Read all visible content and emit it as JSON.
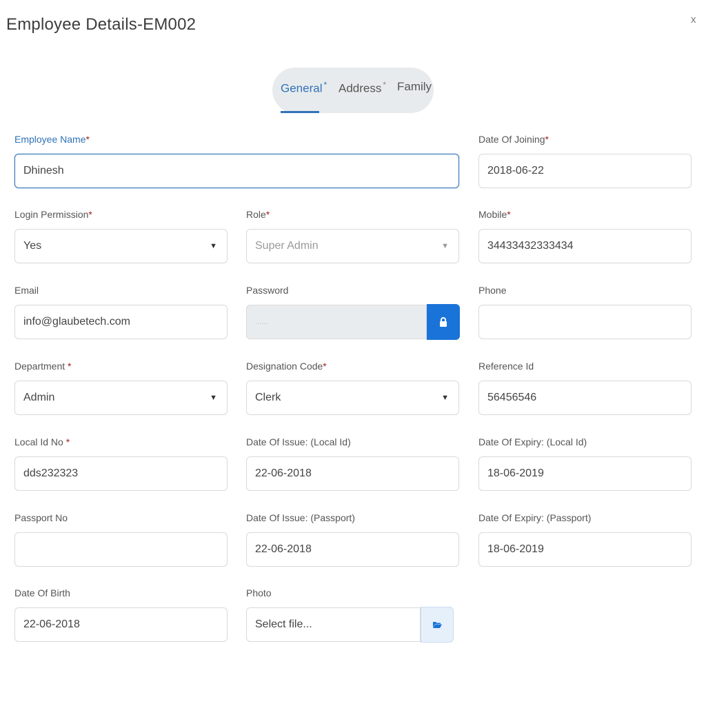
{
  "header": {
    "title": "Employee Details-EM002",
    "close": "x"
  },
  "tabs": [
    {
      "label": "General",
      "marker": "*"
    },
    {
      "label": "Address",
      "marker": "*"
    },
    {
      "label": "Family"
    }
  ],
  "form": {
    "employee_name": {
      "label": "Employee Name",
      "required": "*",
      "value": "Dhinesh"
    },
    "date_of_joining": {
      "label": "Date Of Joining",
      "required": "*",
      "value": "2018-06-22"
    },
    "login_permission": {
      "label": "Login Permission",
      "required": "*",
      "value": "Yes"
    },
    "role": {
      "label": "Role",
      "required": "*",
      "value": "Super Admin"
    },
    "mobile": {
      "label": "Mobile",
      "required": "*",
      "value": "34433432333434"
    },
    "email": {
      "label": "Email",
      "value": "info@glaubetech.com"
    },
    "password": {
      "label": "Password",
      "value": "......"
    },
    "phone": {
      "label": "Phone",
      "value": ""
    },
    "department": {
      "label": "Department ",
      "required": "*",
      "value": "Admin"
    },
    "designation_code": {
      "label": "Designation Code",
      "required": "*",
      "value": "Clerk"
    },
    "reference_id": {
      "label": "Reference Id",
      "value": "56456546"
    },
    "local_id_no": {
      "label": "Local Id No ",
      "required": "*",
      "value": "dds232323"
    },
    "date_issue_local": {
      "label": "Date Of Issue: (Local Id)",
      "value": "22-06-2018"
    },
    "date_expiry_local": {
      "label": "Date Of Expiry: (Local Id)",
      "value": "18-06-2019"
    },
    "passport_no": {
      "label": "Passport No",
      "value": ""
    },
    "date_issue_passport": {
      "label": "Date Of Issue: (Passport)",
      "value": "22-06-2018"
    },
    "date_expiry_passport": {
      "label": "Date Of Expiry: (Passport)",
      "value": "18-06-2019"
    },
    "date_of_birth": {
      "label": "Date Of Birth",
      "value": "22-06-2018"
    },
    "photo": {
      "label": "Photo",
      "placeholder": "Select file..."
    }
  },
  "icons": {
    "caret": "▼",
    "password_toggle": "lock-icon",
    "file_browse": "folder-open-icon"
  },
  "colors": {
    "accent": "#2f72b8",
    "required": "#a31f1f",
    "lock_button": "#1a73d9"
  }
}
